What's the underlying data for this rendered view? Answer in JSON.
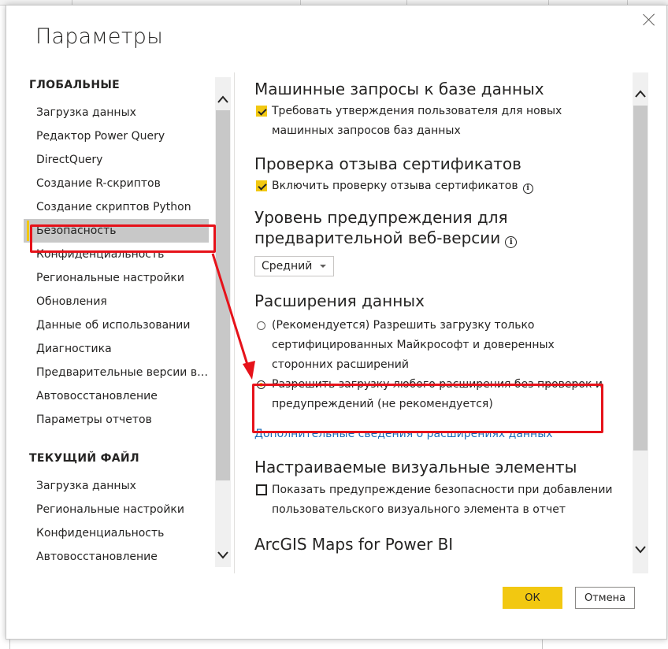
{
  "dialog": {
    "title": "Параметры",
    "close_label": "×"
  },
  "nav": {
    "global_header": "ГЛОБАЛЬНЫЕ",
    "global_items": [
      {
        "label": "Загрузка данных"
      },
      {
        "label": "Редактор Power Query"
      },
      {
        "label": "DirectQuery"
      },
      {
        "label": "Создание R-скриптов"
      },
      {
        "label": "Создание скриптов Python"
      },
      {
        "label": "Безопасность",
        "selected": true
      },
      {
        "label": "Конфиденциальность"
      },
      {
        "label": "Региональные настройки"
      },
      {
        "label": "Обновления"
      },
      {
        "label": "Данные об использовании"
      },
      {
        "label": "Диагностика"
      },
      {
        "label": "Предварительные версии во..."
      },
      {
        "label": "Автовосстановление"
      },
      {
        "label": "Параметры отчетов"
      }
    ],
    "current_header": "ТЕКУЩИЙ ФАЙЛ",
    "current_items": [
      {
        "label": "Загрузка данных"
      },
      {
        "label": "Региональные настройки"
      },
      {
        "label": "Конфиденциальность"
      },
      {
        "label": "Автовосстановление"
      }
    ],
    "scroll_fraction": 0.78
  },
  "content": {
    "native_queries": {
      "title": "Машинные запросы к базе данных",
      "option_line1": "Требовать утверждения пользователя для новых",
      "option_line2": "машинных запросов баз данных",
      "checked": true
    },
    "cert_revocation": {
      "title": "Проверка отзыва сертификатов",
      "option": "Включить проверку отзыва сертификатов",
      "checked": true
    },
    "preview_warning": {
      "title_line1": "Уровень предупреждения для",
      "title_line2": "предварительной веб-версии",
      "selected_value": "Средний"
    },
    "data_extensions": {
      "title": "Расширения данных",
      "option1_line1": "(Рекомендуется) Разрешить загрузку только",
      "option1_line2": "сертифицированных Майкрософт и доверенных",
      "option1_line3": "сторонних расширений",
      "option2_line1": "Разрешить загрузку любого расширения без проверок и",
      "option2_line2": "предупреждений (не рекомендуется)",
      "selected_option": 2,
      "link": "Дополнительные сведения о расширениях данных"
    },
    "custom_visuals": {
      "title": "Настраиваемые визуальные элементы",
      "option_line1": "Показать предупреждение безопасности при добавлении",
      "option_line2": "пользовательского визуального элемента в отчет",
      "checked": false
    },
    "arcgis": {
      "title": "ArcGIS Maps for Power BI"
    },
    "scroll_fraction": 0.78
  },
  "footer": {
    "ok_label": "ОК",
    "cancel_label": "Отмена"
  },
  "colors": {
    "accent": "#f2c811",
    "link": "#1a6bb8",
    "annotation": "#e6121a",
    "selection": "#c8c8c8"
  }
}
